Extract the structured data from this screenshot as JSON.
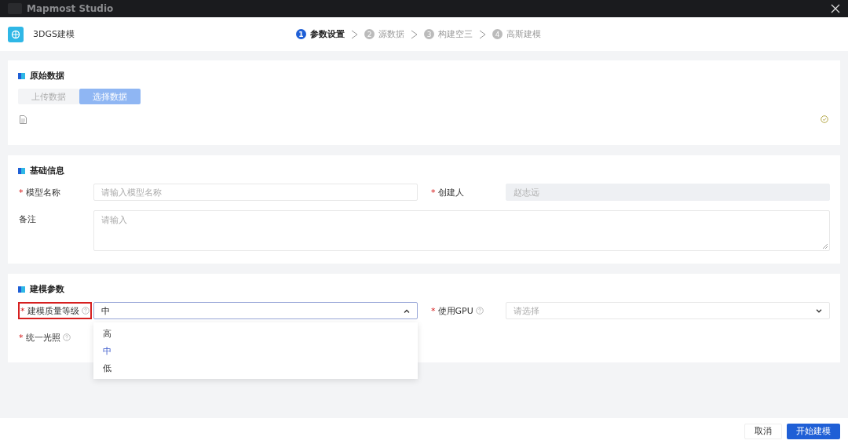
{
  "app_bar": {
    "title": "Mapmost Studio"
  },
  "modal": {
    "title": "3DGS建模",
    "steps": [
      {
        "number": "1",
        "label": "参数设置",
        "selected": true
      },
      {
        "number": "2",
        "label": "源数据",
        "selected": false
      },
      {
        "number": "3",
        "label": "构建空三",
        "selected": false
      },
      {
        "number": "4",
        "label": "高斯建模",
        "selected": false
      }
    ]
  },
  "source_section": {
    "title": "原始数据",
    "segments": [
      {
        "label": "上传数据",
        "selected": false
      },
      {
        "label": "选择数据",
        "selected": true
      }
    ]
  },
  "basic_section": {
    "title": "基础信息",
    "rows": [
      [
        {
          "required_mark": "*",
          "label": "模型名称",
          "kind": "input",
          "placeholder": "请输入模型名称"
        },
        {
          "required_mark": "*",
          "label": "创建人",
          "kind": "input",
          "value": "赵志远",
          "disabled": true
        }
      ],
      [
        {
          "label": "备注",
          "kind": "textarea",
          "placeholder": "请输入"
        }
      ]
    ]
  },
  "params_section": {
    "title": "建模参数",
    "rows": [
      [
        {
          "required_mark": "*",
          "label": "建模质量等级",
          "help": true,
          "highlighted": true,
          "kind": "select",
          "value": "中",
          "expanded": true,
          "options": [
            {
              "label": "高",
              "selected": false
            },
            {
              "label": "中",
              "selected": true
            },
            {
              "label": "低",
              "selected": false
            }
          ]
        },
        {
          "required_mark": "*",
          "label": "使用GPU",
          "help": true,
          "highlighted": false,
          "kind": "select",
          "placeholder": "请选择",
          "expanded": false
        }
      ],
      [
        {
          "required_mark": "*",
          "label": "统一光照",
          "help": true,
          "highlighted": false,
          "kind": "hidden"
        }
      ]
    ]
  },
  "footer": {
    "buttons": [
      {
        "label": "取消",
        "kind": "secondary"
      },
      {
        "label": "开始建模",
        "kind": "primary"
      }
    ]
  }
}
